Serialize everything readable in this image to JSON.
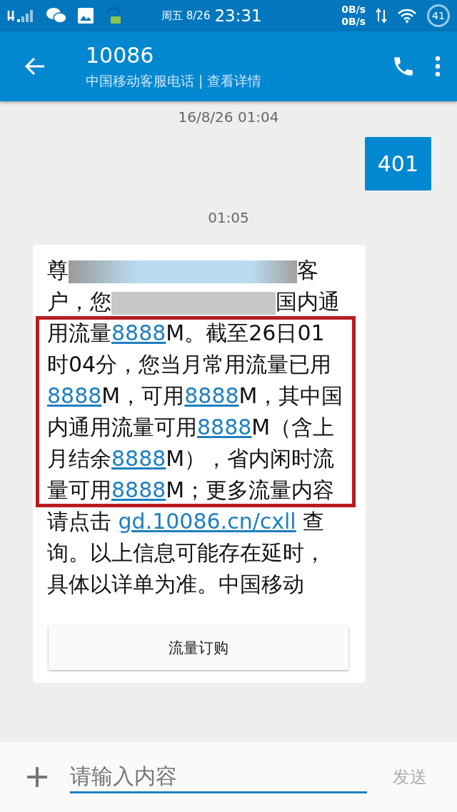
{
  "status_bar": {
    "date": "周五 8/26",
    "time": "23:31",
    "upload_speed": "0B/s",
    "download_speed": "0B/s",
    "battery": "41"
  },
  "header": {
    "title": "10086",
    "subtitle": "中国移动客服电话 | 查看详情"
  },
  "messages": [
    {
      "kind": "timestamp",
      "text": "16/8/26 01:04"
    },
    {
      "kind": "sent",
      "text": "401"
    },
    {
      "kind": "timestamp",
      "text": "01:05"
    },
    {
      "kind": "received",
      "highlighted": true,
      "action": "流量订购",
      "parts": [
        {
          "kind": "text",
          "text": "尊"
        },
        {
          "kind": "blur"
        },
        {
          "kind": "text",
          "text": "客户，您"
        },
        {
          "kind": "blur"
        },
        {
          "kind": "text",
          "text": "国内通用流量"
        },
        {
          "kind": "link",
          "text": "8888"
        },
        {
          "kind": "text",
          "text": "M。截至26日01时04分，您当月常用流量已用"
        },
        {
          "kind": "link",
          "text": "8888"
        },
        {
          "kind": "text",
          "text": "M，可用"
        },
        {
          "kind": "link",
          "text": "8888"
        },
        {
          "kind": "text",
          "text": "M，其中国内通用流量可用"
        },
        {
          "kind": "link",
          "text": "8888"
        },
        {
          "kind": "text",
          "text": "M（含上月结余"
        },
        {
          "kind": "link",
          "text": "8888"
        },
        {
          "kind": "text",
          "text": "M），省内闲时流量可用"
        },
        {
          "kind": "link",
          "text": "8888"
        },
        {
          "kind": "text",
          "text": "M；更多流量内容请点击 "
        },
        {
          "kind": "link",
          "text": "gd.10086.cn/cxll"
        },
        {
          "kind": "text",
          "text": " 查询。以上信息可能存在延时，具体以详单为准。中国移动"
        }
      ]
    }
  ],
  "composer": {
    "placeholder": "请输入内容",
    "send": "发送",
    "send_disabled": true
  }
}
